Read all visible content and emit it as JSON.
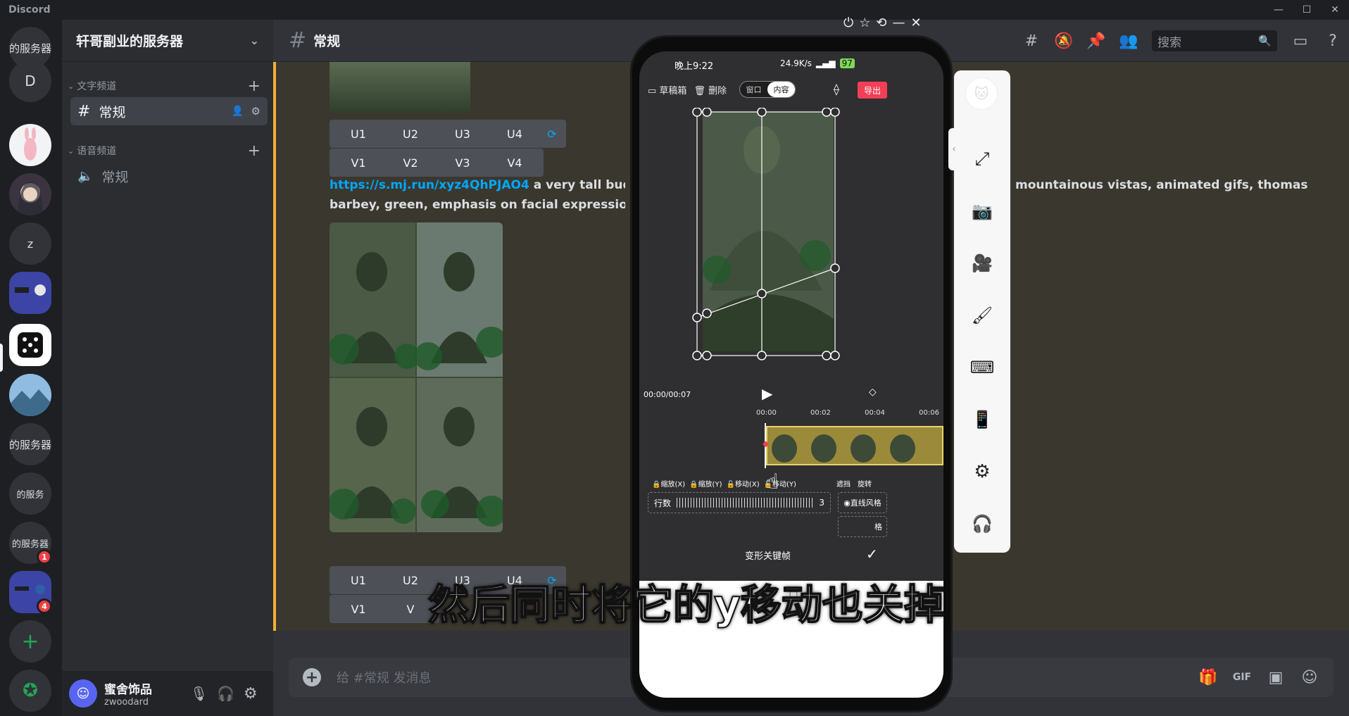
{
  "titlebar": {
    "brand": "Discord",
    "controls": [
      "—",
      "☐",
      "✕"
    ]
  },
  "servers": [
    {
      "label": "的服务器",
      "kind": "text"
    },
    {
      "label": "D",
      "kind": "text"
    },
    {
      "label": "",
      "kind": "rabbit"
    },
    {
      "label": "",
      "kind": "girl"
    },
    {
      "label": "z",
      "kind": "text"
    },
    {
      "label": "",
      "kind": "mixed"
    },
    {
      "label": "",
      "kind": "dice"
    },
    {
      "label": "",
      "kind": "landscape"
    },
    {
      "label": "的服务器",
      "kind": "text"
    },
    {
      "label": "的服务",
      "kind": "text"
    },
    {
      "label": "的服务器",
      "kind": "text",
      "badge": "1"
    },
    {
      "label": "",
      "kind": "mixed",
      "badge": "4"
    }
  ],
  "guild": {
    "name": "轩哥副业的服务器"
  },
  "categories": [
    {
      "label": "文字频道"
    },
    {
      "label": "语音频道"
    }
  ],
  "channels": [
    {
      "label": "常规",
      "type": "text",
      "selected": true
    },
    {
      "label": "常规",
      "type": "voice"
    }
  ],
  "user": {
    "name": "蜜舍饰品",
    "tag": "zwoodard"
  },
  "channel_header": {
    "name": "常规",
    "search_placeholder": "搜索"
  },
  "messages": {
    "buttons_row1": [
      "U1",
      "U2",
      "U3",
      "U4"
    ],
    "buttons_row2": [
      "V1",
      "V2",
      "V3",
      "V4"
    ],
    "link": "https://s.mj.run/xyz4QhPJAO4",
    "text_line1_left": "a very tall budd",
    "text_line1_right": "mountainous vistas, animated gifs, thomas",
    "text_line2": "barbey, green, emphasis on facial expression, h",
    "buttons2_row1": [
      "U1",
      "U2",
      "U3",
      "U4"
    ],
    "buttons2_row2": [
      "V1",
      "V"
    ]
  },
  "composer": {
    "placeholder": "给 #常规 发消息"
  },
  "phone": {
    "time": "晚上9:22",
    "net": "24.9K/s",
    "battery": "97",
    "drafts": "草稿箱",
    "delete": "删除",
    "mode_window": "窗口",
    "mode_content": "内容",
    "export": "导出",
    "timecode": "00:00/00:07",
    "ticks": [
      "00:00",
      "00:02",
      "00:04",
      "00:06"
    ],
    "opts": [
      "缩放(X)",
      "缩放(Y)",
      "移动(X)",
      "移动(Y)"
    ],
    "mask": "遮挡",
    "rotate": "旋转",
    "rows_label": "行数",
    "rows_value": "3",
    "style_line": "直线风格",
    "style_grid": "格",
    "keyframe": "变形关键帧"
  },
  "subtitle": "然后同时将它的y移动也关掉",
  "colors": {
    "accent": "#5865f2",
    "export": "#f23f55",
    "highlight_bar": "#f0b232"
  }
}
